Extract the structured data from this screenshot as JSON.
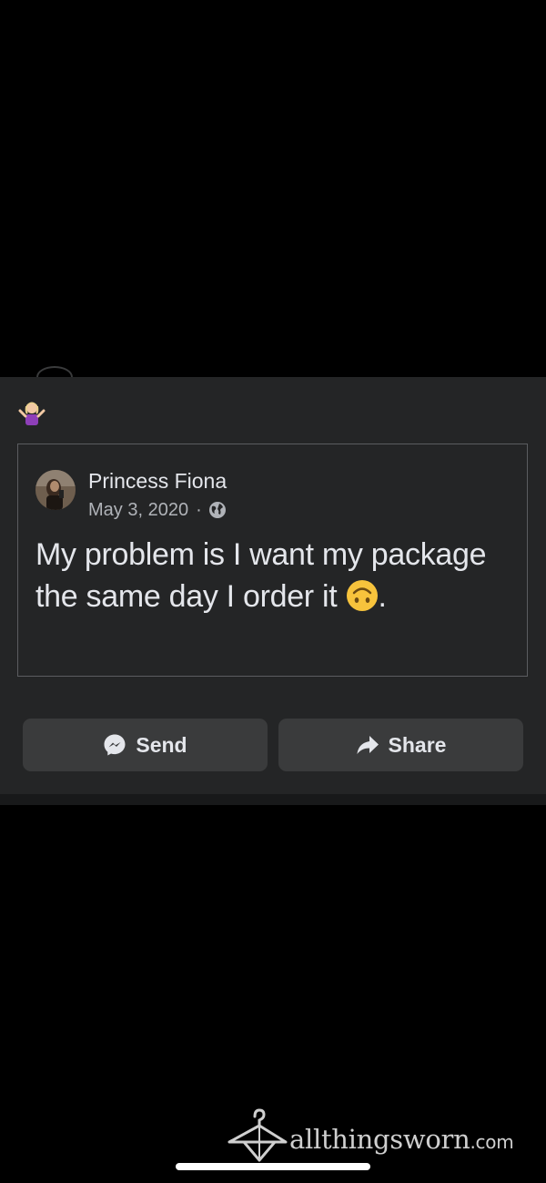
{
  "shared_post": {
    "author": "Princess Fiona",
    "date": "May 3, 2020",
    "separator": "·",
    "privacy_icon": "globe-icon",
    "text": "My problem is I want my package the same day I order it",
    "text_suffix": ".",
    "inline_emoji": "upside-down-face-emoji"
  },
  "reaction": {
    "emoji": "person-shrugging-emoji"
  },
  "actions": {
    "send_label": "Send",
    "send_icon": "messenger-icon",
    "share_label": "Share",
    "share_icon": "share-arrow-icon"
  },
  "watermark": {
    "brand": "allthingsworn",
    "tld": ".com",
    "icon": "hanger-icon"
  },
  "colors": {
    "background": "#000000",
    "card": "#242526",
    "button": "#3a3b3c",
    "text_primary": "#e4e6eb",
    "text_secondary": "#b0b3b8",
    "border": "#5b5d60"
  }
}
